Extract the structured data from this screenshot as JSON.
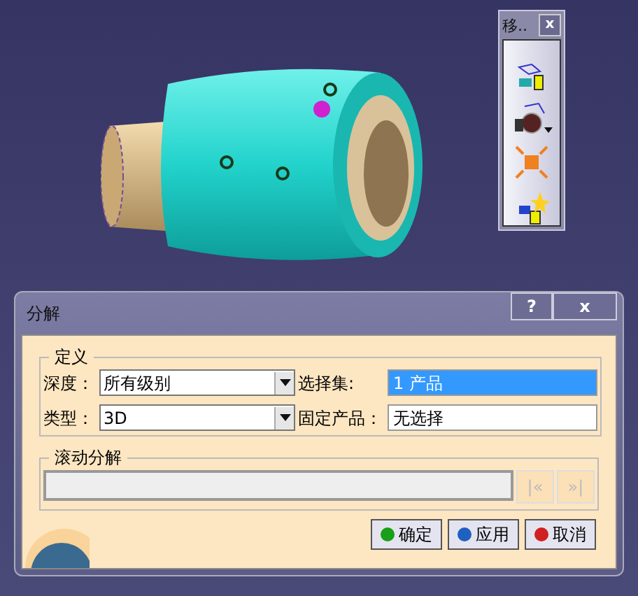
{
  "toolbar": {
    "title": "移..",
    "close": "x"
  },
  "dialog": {
    "title": "分解",
    "help": "?",
    "close": "x",
    "definition": {
      "title": "定义",
      "rows": [
        {
          "label": "深度：",
          "value": "所有级别",
          "side_label": "选择集:",
          "side_value": "1 产品",
          "side_selected": true
        },
        {
          "label": "类型：",
          "value": "3D",
          "side_label": "固定产品：",
          "side_value": "无选择",
          "side_selected": false
        }
      ]
    },
    "scroll": {
      "title": "滚动分解",
      "first": "|«",
      "last": "»|"
    },
    "buttons": [
      {
        "label": "确定",
        "kind": "ok"
      },
      {
        "label": "应用",
        "kind": "apply"
      },
      {
        "label": "取消",
        "kind": "cancel"
      }
    ]
  }
}
